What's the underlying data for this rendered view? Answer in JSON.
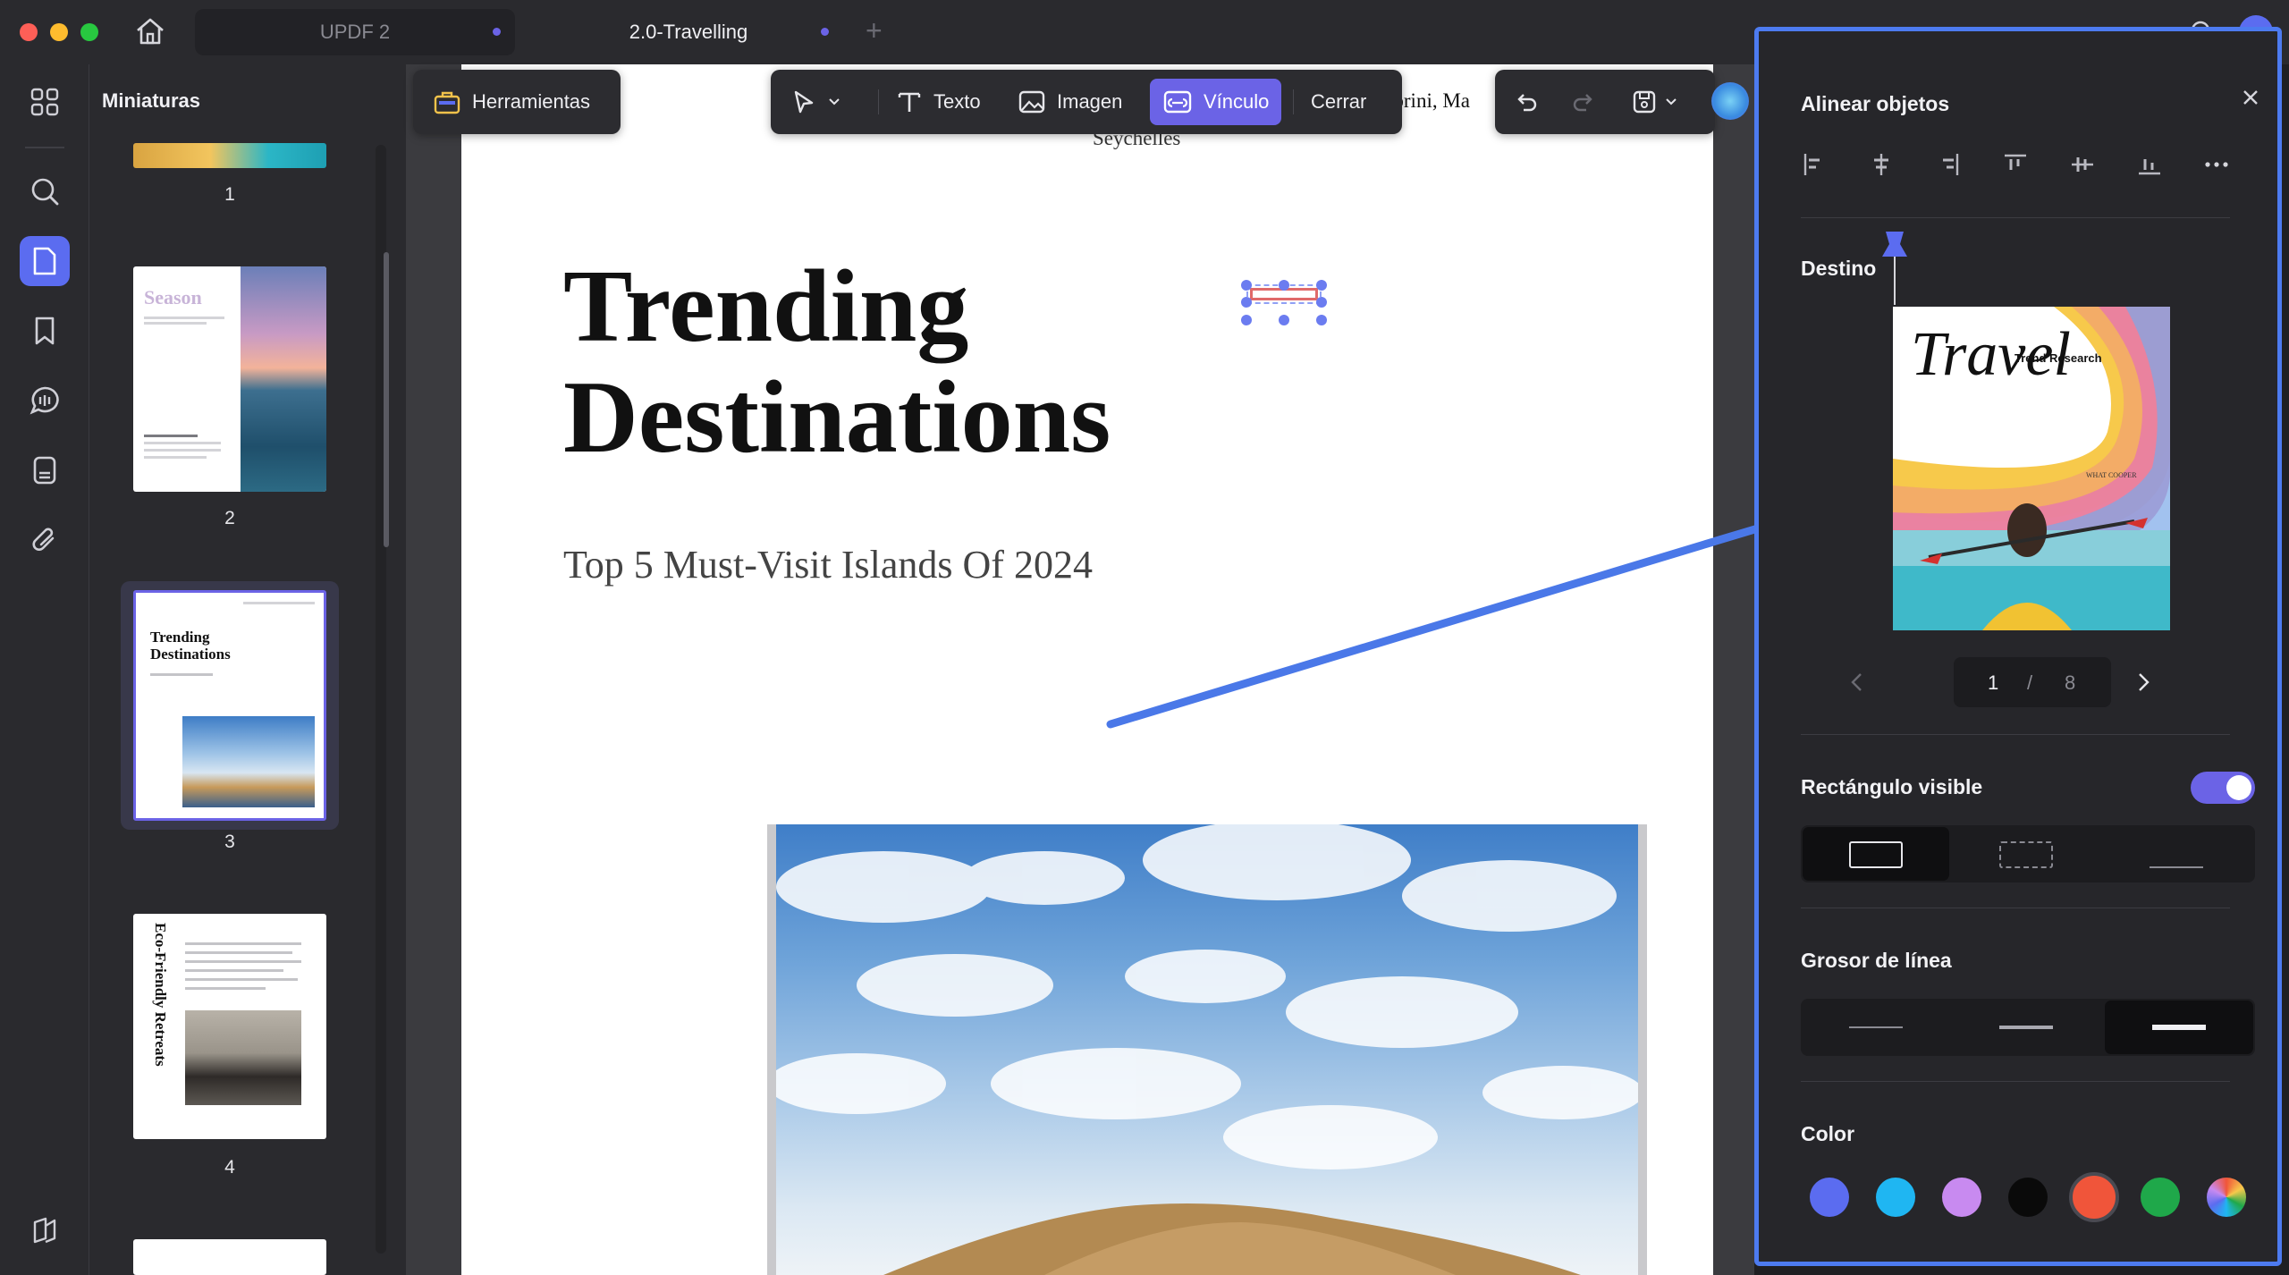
{
  "titlebar": {
    "tabs": [
      {
        "label": "UPDF 2",
        "active": false
      },
      {
        "label": "2.0-Travelling",
        "active": true
      }
    ],
    "new_tab": "+"
  },
  "thumbnails": {
    "title": "Miniaturas",
    "pages": [
      {
        "number": "1"
      },
      {
        "number": "2",
        "heading": "Season"
      },
      {
        "number": "3",
        "heading": "Trending Destinations"
      },
      {
        "number": "4",
        "heading": "Eco-Friendly Retreats"
      }
    ]
  },
  "toolbar": {
    "tools_label": "Herramientas",
    "text_label": "Texto",
    "image_label": "Imagen",
    "link_label": "Vínculo",
    "close_label": "Cerrar"
  },
  "document": {
    "header_fragment": "torini, Ma",
    "header_line2": "Seychelles",
    "title_line1": "Trending",
    "title_line2": "Destinations",
    "subtitle": "Top 5 Must-Visit Islands Of 2024"
  },
  "panel": {
    "align_title": "Alinear objetos",
    "destination_label": "Destino",
    "preview": {
      "script_title": "Travel",
      "subtitle": "Trend Research",
      "author": "WHAT COOPER"
    },
    "pager": {
      "current": "1",
      "separator": "/",
      "total": "8"
    },
    "visible_rect_label": "Rectángulo visible",
    "visible_rect_on": true,
    "line_thickness_label": "Grosor de línea",
    "color_label": "Color",
    "colors": [
      "#5b6cf0",
      "#1fb6f2",
      "#c88af0",
      "#0a0a0a",
      "#f0553a",
      "#1fa84a",
      "rainbow"
    ],
    "selected_color": "#f0553a",
    "accent": "#4d7bf0"
  }
}
